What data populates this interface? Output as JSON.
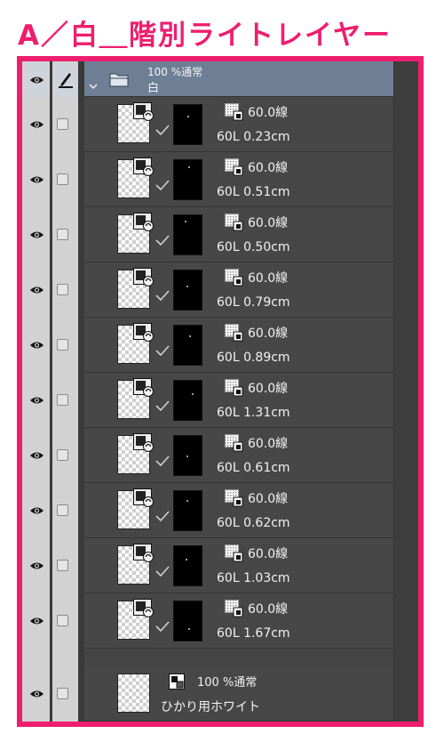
{
  "heading": {
    "title": "A／白＿階別ライトレイヤー",
    "color": "#ee1e6e"
  },
  "folder": {
    "opacity_mode": "100 %通常",
    "name": "白",
    "icons": [
      "eye-icon",
      "pen-icon",
      "chevron-down-icon",
      "folder-icon"
    ]
  },
  "layers": [
    {
      "mode_value": "60.0線",
      "label": "60L 0.23cm"
    },
    {
      "mode_value": "60.0線",
      "label": "60L 0.51cm"
    },
    {
      "mode_value": "60.0線",
      "label": "60L 0.50cm"
    },
    {
      "mode_value": "60.0線",
      "label": "60L 0.79cm"
    },
    {
      "mode_value": "60.0線",
      "label": "60L 0.89cm"
    },
    {
      "mode_value": "60.0線",
      "label": "60L 1.31cm"
    },
    {
      "mode_value": "60.0線",
      "label": "60L 0.61cm"
    },
    {
      "mode_value": "60.0線",
      "label": "60L 0.62cm"
    },
    {
      "mode_value": "60.0線",
      "label": "60L 1.03cm"
    },
    {
      "mode_value": "60.0線",
      "label": "60L 1.67cm"
    }
  ],
  "bottom_layer": {
    "opacity_mode": "100 %通常",
    "name": "ひかり用ホワイト"
  }
}
